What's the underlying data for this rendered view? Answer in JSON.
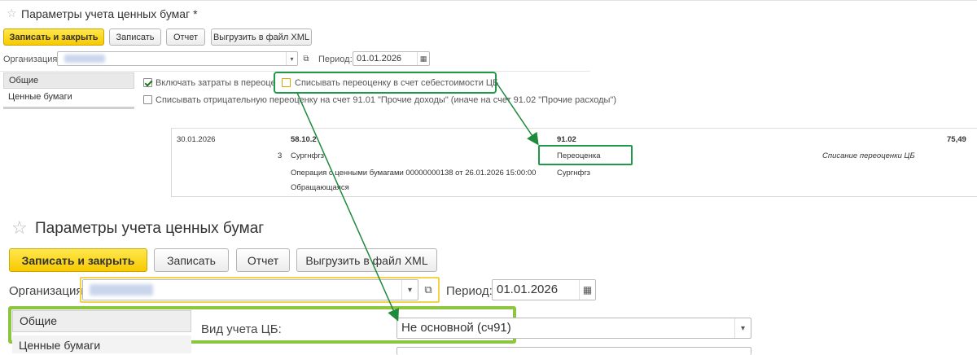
{
  "small_form": {
    "title": "Параметры учета ценных бумаг *",
    "buttons": {
      "save_close": "Записать и закрыть",
      "save": "Записать",
      "report": "Отчет",
      "export_xml": "Выгрузить в файл XML"
    },
    "org_label": "Организация:",
    "period_label": "Период:",
    "period_value": "01.01.2026",
    "tabs": [
      "Общие",
      "Ценные бумаги"
    ],
    "checkboxes": {
      "include_costs": {
        "label": "Включать затраты в переоценку",
        "checked": true
      },
      "write_off_reval": {
        "label": "Списывать переоценку в счет себестоимости ЦБ",
        "checked": false
      },
      "write_off_negative": {
        "label": "Списывать отрицательную переоценку на счет 91.01 \"Прочие доходы\" (иначе на счет 91.02 \"Прочие расходы\")",
        "checked": false
      }
    }
  },
  "report": {
    "date": "30.01.2026",
    "debit_account": "58.10.2",
    "credit_account": "91.02",
    "amount": "75,49",
    "qty": "3",
    "debit_sub1": "Сургнфгз",
    "credit_sub1": "Переоценка",
    "description": "Списание переоценки ЦБ",
    "debit_sub2": "Операция с ценными бумагами 00000000138 от 26.01.2026 15:00:00",
    "credit_sub2": "Сургнфгз",
    "debit_sub3": "Обращающаяся"
  },
  "large_form": {
    "title": "Параметры учета ценных бумаг",
    "buttons": {
      "save_close": "Записать и закрыть",
      "save": "Записать",
      "report": "Отчет",
      "export_xml": "Выгрузить в файл XML"
    },
    "org_label": "Организация:",
    "period_label": "Период:",
    "period_value": "01.01.2026",
    "tabs": [
      "Общие",
      "Ценные бумаги"
    ],
    "accounting_type_label": "Вид учета ЦБ:",
    "accounting_type_value": "Не основной (сч91)"
  },
  "colors": {
    "highlight_green": "#1f9a4a",
    "highlight_yellow": "#f2d34b",
    "highlight_lime": "#8cc63e",
    "primary_button": "#f7c900"
  },
  "icons": {
    "star": "star-icon",
    "dropdown": "dropdown-arrow-icon",
    "open": "open-form-icon",
    "calendar": "calendar-icon"
  }
}
